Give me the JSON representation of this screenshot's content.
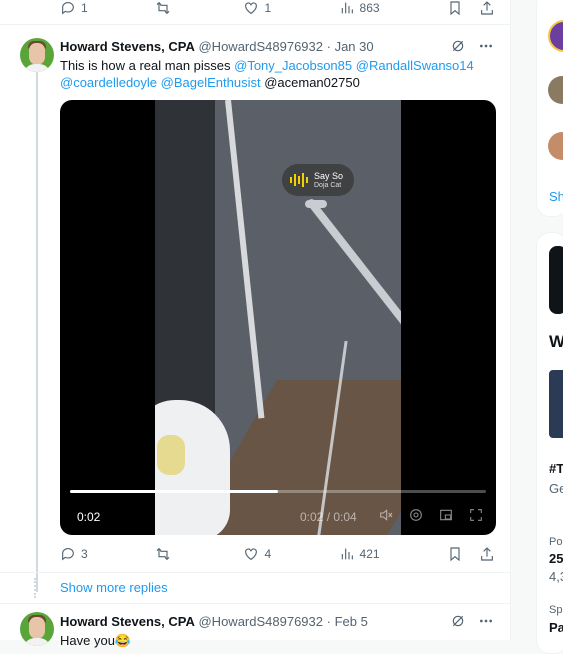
{
  "top_actions": {
    "replies": "1",
    "reposts": "",
    "likes": "1",
    "views": "863"
  },
  "tweet1": {
    "name": "Howard Stevens, CPA",
    "handle": "@HowardS48976932",
    "date": "· Jan 30",
    "text_lead": "This is how a real man pisses ",
    "mentions": [
      "@Tony_Jacobson85",
      "@RandallSwanso14",
      "@coardelledoyle",
      "@BagelEnthusist"
    ],
    "text_tail": "@aceman02750",
    "video": {
      "elapsed": "0:02",
      "duration_display": "0:02 / 0:04",
      "progress": 0.5,
      "sticker_title": "Say So",
      "sticker_artist": "Doja Cat"
    },
    "actions": {
      "replies": "3",
      "reposts": "",
      "likes": "4",
      "views": "421"
    }
  },
  "show_more": "Show more replies",
  "tweet2": {
    "name": "Howard Stevens, CPA",
    "handle": "@HowardS48976932",
    "date": "· Feb 5",
    "text": "Have you😂"
  },
  "sidebar": {
    "show_text": "Sh",
    "heading": "W",
    "trend_tag": "#T",
    "trend_sub": "Ge",
    "post_label": "Po",
    "post_count": "25",
    "post_sub": "4,3",
    "sponsored_label": "Sp",
    "sponsored_text": "Pa"
  },
  "colors": {
    "accent": "#1d9bf0",
    "text": "#0f1419",
    "muted": "#536471",
    "sticker_bars": "#f5d000"
  }
}
